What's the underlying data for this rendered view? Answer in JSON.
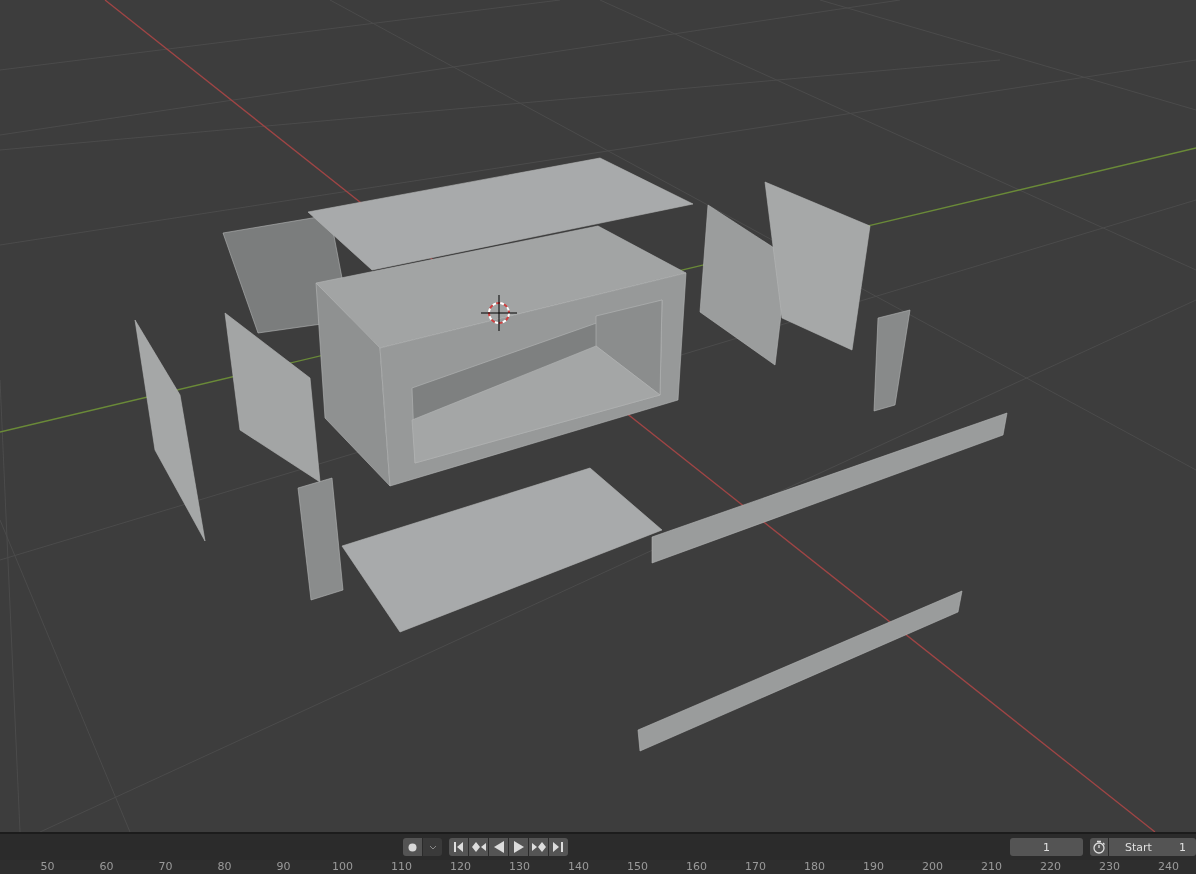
{
  "timeline": {
    "current_frame": "1",
    "start_label": "Start",
    "start_value": "1"
  },
  "ruler_ticks": [
    "50",
    "60",
    "70",
    "80",
    "90",
    "100",
    "110",
    "120",
    "130",
    "140",
    "150",
    "160",
    "170",
    "180",
    "190",
    "200",
    "210",
    "220",
    "230",
    "240"
  ]
}
